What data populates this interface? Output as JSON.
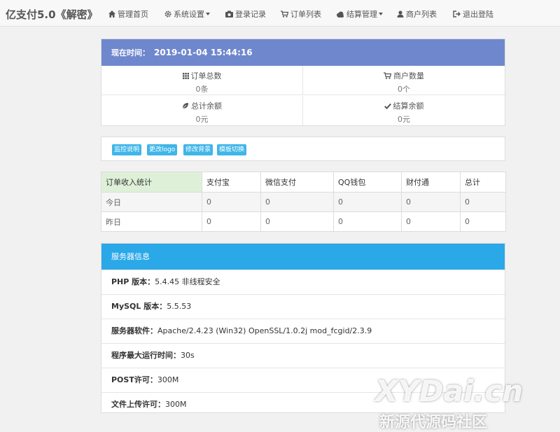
{
  "nav": {
    "brand": "亿支付5.0《解密》",
    "items": [
      {
        "label": "管理首页",
        "icon": "home-icon"
      },
      {
        "label": "系统设置",
        "icon": "gear-icon"
      },
      {
        "label": "登录记录",
        "icon": "camera-icon"
      },
      {
        "label": "订单列表",
        "icon": "cart-icon"
      },
      {
        "label": "结算管理",
        "icon": "cloud-icon"
      },
      {
        "label": "商户列表",
        "icon": "user-icon"
      },
      {
        "label": "退出登陆",
        "icon": "logout-icon"
      }
    ]
  },
  "summary": {
    "time_label": "现在时间：",
    "time_value": "2019-01-04 15:44:16",
    "stats": [
      {
        "label": "订单总数",
        "value": "0条",
        "icon": "grid-icon"
      },
      {
        "label": "商户数量",
        "value": "0个",
        "icon": "cart-icon"
      },
      {
        "label": "总计余额",
        "value": "0元",
        "icon": "leaf-icon"
      },
      {
        "label": "结算余额",
        "value": "0元",
        "icon": "check-icon"
      }
    ]
  },
  "buttons": [
    "监控说明",
    "更改logo",
    "修改背景",
    "模板切换"
  ],
  "income_table": {
    "headers": [
      "订单收入统计",
      "支付宝",
      "微信支付",
      "QQ钱包",
      "财付通",
      "总计"
    ],
    "rows": [
      [
        "今日",
        "0",
        "0",
        "0",
        "0",
        "0"
      ],
      [
        "昨日",
        "0",
        "0",
        "0",
        "0",
        "0"
      ]
    ]
  },
  "server": {
    "title": "服务器信息",
    "rows": [
      {
        "key": "PHP 版本：",
        "value": "5.4.45 非线程安全"
      },
      {
        "key": "MySQL 版本：",
        "value": "5.5.53"
      },
      {
        "key": "服务器软件：",
        "value": "Apache/2.4.23 (Win32) OpenSSL/1.0.2j mod_fcgid/2.3.9"
      },
      {
        "key": "程序最大运行时间：",
        "value": "30s"
      },
      {
        "key": "POST许可：",
        "value": "300M"
      },
      {
        "key": "文件上传许可：",
        "value": "300M"
      }
    ]
  },
  "watermark": {
    "line1": "XYDai.cn",
    "line2": "新源代源码社区"
  },
  "colors": {
    "header_blue": "#6f87cd",
    "server_blue": "#2aa8e8",
    "button_blue": "#3fb6e8",
    "table_corner": "#dff0d8"
  }
}
